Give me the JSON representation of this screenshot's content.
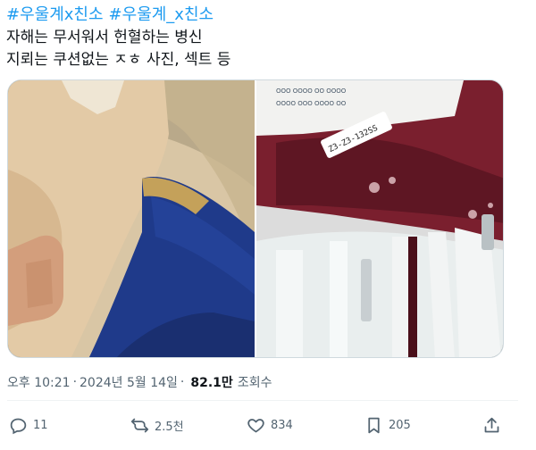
{
  "post": {
    "hashtags": [
      "#우울계x친소",
      "#우울계_x친소"
    ],
    "lines": [
      "자해는 무서워서 헌혈하는 병신",
      "지뢰는 쿠션없는 ㅈㅎ 사진, 섹트 등"
    ],
    "media": {
      "bag_label": "Z3-Z3-132SS"
    },
    "timestamp": {
      "time": "오후 10:21",
      "separator": "·",
      "date": "2024년 5월 14일",
      "views_count": "82.1만",
      "views_label": "조회수"
    },
    "actions": {
      "replies": "11",
      "reposts": "2.5천",
      "likes": "834",
      "bookmarks": "205"
    }
  },
  "colors": {
    "accent": "#1d9bf0",
    "secondary_text": "#536471",
    "primary_text": "#0f1419"
  },
  "icons": [
    "reply-icon",
    "repost-icon",
    "like-icon",
    "bookmark-icon",
    "share-icon"
  ]
}
